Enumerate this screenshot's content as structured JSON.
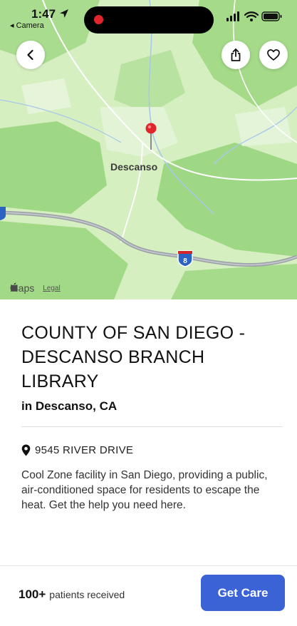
{
  "status_bar": {
    "time": "1:47",
    "back_app": "◂ Camera"
  },
  "map": {
    "place_label": "Descanso",
    "highway_shield": "8",
    "credit_brand": "Maps",
    "credit_legal": "Legal",
    "colors": {
      "land": "#d6efc0",
      "forest": "#9fd884",
      "road": "#9aa0a6",
      "water": "#a7c8e8",
      "pin": "#e0262b"
    }
  },
  "header_actions": {
    "back_icon": "chevron-left-icon",
    "share_icon": "share-icon",
    "favorite_icon": "heart-icon"
  },
  "place": {
    "title": "COUNTY OF SAN DIEGO - DESCANSO BRANCH LIBRARY",
    "subtitle": "in Descanso, CA",
    "address": "9545 RIVER DRIVE",
    "description": "Cool Zone facility in San Diego, providing a public, air-conditioned space for residents to escape the heat. Get the help you need here."
  },
  "footer": {
    "patients_count": "100+",
    "patients_label": "patients received",
    "cta_label": "Get Care",
    "cta_color": "#3b63d6"
  }
}
